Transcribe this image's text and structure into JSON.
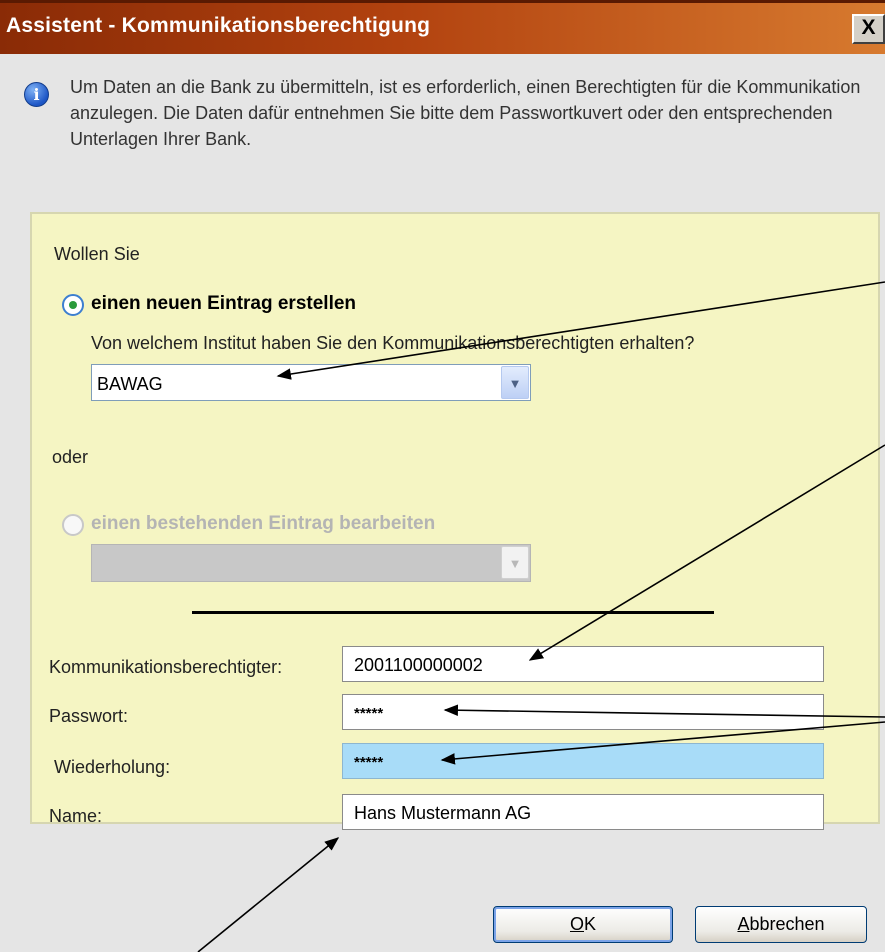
{
  "window": {
    "title": "Assistent - Kommunikationsberechtigung",
    "close_label": "X"
  },
  "info": {
    "icon": "info-icon",
    "text": "Um Daten an die Bank zu übermitteln, ist es erforderlich, einen Berechtigten für die Kommunikation anzulegen. Die Daten dafür entnehmen Sie bitte dem Passwortkuvert oder den entsprechenden Unterlagen Ihrer Bank."
  },
  "form": {
    "question": "Wollen Sie",
    "option_new": {
      "label": "einen neuen Eintrag erstellen",
      "selected": true
    },
    "institute_question": "Von welchem Institut haben Sie den Kommunikationsberechtigten erhalten?",
    "institute_value": "BAWAG",
    "or_label": "oder",
    "option_edit": {
      "label": "einen bestehenden Eintrag bearbeiten",
      "selected": false,
      "disabled": true
    },
    "existing_value": "",
    "fields": {
      "comm_label": "Kommunikationsberechtigter:",
      "comm_value": "2001100000002",
      "password_label": "Passwort:",
      "password_value": "*****",
      "repeat_label": "Wiederholung:",
      "repeat_value": "*****",
      "name_label": "Name:",
      "name_value": "Hans Mustermann AG"
    }
  },
  "buttons": {
    "ok": "OK",
    "cancel": "Abbrechen"
  },
  "colors": {
    "titlebar": "#b2420f",
    "panel": "#f5f5c3",
    "highlight_field": "#a8dcf8"
  }
}
